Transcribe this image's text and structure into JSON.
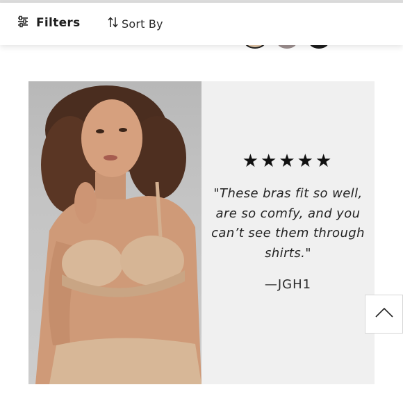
{
  "toolbar": {
    "filters_label": "Filters",
    "sort_label": "Sort By",
    "filters_icon": "sliders-icon",
    "sort_icon": "sort-arrows-icon"
  },
  "swatches": [
    {
      "name": "nude",
      "color": "#e2c7a8",
      "selected": true
    },
    {
      "name": "gray",
      "color": "#9c8f8f",
      "selected": false
    },
    {
      "name": "black",
      "color": "#1b1b1b",
      "selected": false
    }
  ],
  "review": {
    "stars": "★★★★★",
    "rating": 5,
    "quote": "\"These bras fit so well, are so comfy, and you can’t see them through shirts.\"",
    "author": "—JGH1"
  },
  "scroll_top": {
    "icon": "chevron-up-icon"
  },
  "colors": {
    "card_bg": "#f0f0f0",
    "text": "#1a1a1a"
  }
}
